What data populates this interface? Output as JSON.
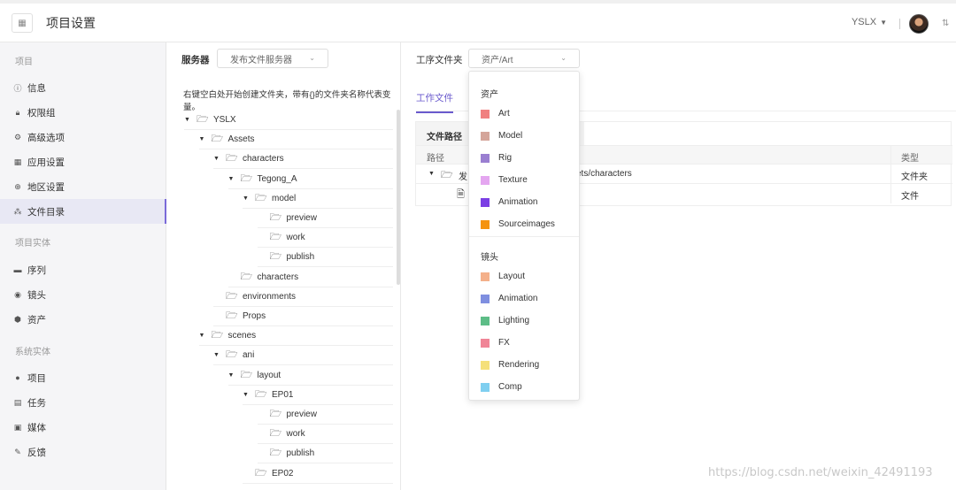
{
  "header": {
    "title": "项目设置",
    "user": "YSLX",
    "apps_icon": "grid-icon",
    "sort_icon": "sort-icon"
  },
  "sidebar": {
    "section_project": "项目",
    "project_items": [
      {
        "label": "信息",
        "icon": "info-icon"
      },
      {
        "label": "权限组",
        "icon": "lock-icon"
      },
      {
        "label": "高级选项",
        "icon": "settings-icon"
      },
      {
        "label": "应用设置",
        "icon": "apps-icon"
      },
      {
        "label": "地区设置",
        "icon": "globe-icon"
      },
      {
        "label": "文件目录",
        "icon": "tree-icon",
        "active": true
      }
    ],
    "section_entities": "项目实体",
    "entity_items": [
      {
        "label": "序列",
        "icon": "sequence-icon"
      },
      {
        "label": "镜头",
        "icon": "shot-icon"
      },
      {
        "label": "资产",
        "icon": "asset-icon"
      }
    ],
    "section_system": "系统实体",
    "system_items": [
      {
        "label": "项目",
        "icon": "project-icon"
      },
      {
        "label": "任务",
        "icon": "task-icon"
      },
      {
        "label": "媒体",
        "icon": "media-icon"
      },
      {
        "label": "反馈",
        "icon": "feedback-icon"
      }
    ]
  },
  "tree_panel": {
    "server_label": "服务器",
    "server_value": "发布文件服务器",
    "hint": "右键空白处开始创建文件夹，带有{}的文件夹名称代表变量。",
    "nodes": [
      {
        "label": "YSLX",
        "level": 0,
        "expanded": true
      },
      {
        "label": "Assets",
        "level": 1,
        "expanded": true
      },
      {
        "label": "characters",
        "level": 2,
        "expanded": true
      },
      {
        "label": "Tegong_A",
        "level": 3,
        "expanded": true
      },
      {
        "label": "model",
        "level": 4,
        "expanded": true
      },
      {
        "label": "preview",
        "level": 5
      },
      {
        "label": "work",
        "level": 5
      },
      {
        "label": "publish",
        "level": 5
      },
      {
        "label": "characters",
        "level": 3
      },
      {
        "label": "environments",
        "level": 2
      },
      {
        "label": "Props",
        "level": 2
      },
      {
        "label": "scenes",
        "level": 1,
        "expanded": true
      },
      {
        "label": "ani",
        "level": 2,
        "expanded": true
      },
      {
        "label": "layout",
        "level": 3,
        "expanded": true
      },
      {
        "label": "EP01",
        "level": 4,
        "expanded": true
      },
      {
        "label": "preview",
        "level": 5
      },
      {
        "label": "work",
        "level": 5
      },
      {
        "label": "publish",
        "level": 5
      },
      {
        "label": "EP02",
        "level": 4
      }
    ]
  },
  "right_panel": {
    "folder_label": "工序文件夹",
    "folder_value": "资产/Art",
    "tab": "工作文件",
    "path_header": "文件路径",
    "col_path": "路径",
    "col_type": "类型",
    "rows": [
      {
        "path_prefix": "发",
        "path_suffix": "ets/characters",
        "type": "文件夹"
      },
      {
        "path_prefix": "",
        "path_suffix": "",
        "type": "文件"
      }
    ]
  },
  "dropdown": {
    "group_asset": "资产",
    "asset_items": [
      {
        "label": "Art",
        "color": "#f08080"
      },
      {
        "label": "Model",
        "color": "#d4a59a"
      },
      {
        "label": "Rig",
        "color": "#9a7fd1"
      },
      {
        "label": "Texture",
        "color": "#e4a6f0"
      },
      {
        "label": "Animation",
        "color": "#7b3fe4"
      },
      {
        "label": "Sourceimages",
        "color": "#f5930f"
      }
    ],
    "group_shot": "镜头",
    "shot_items": [
      {
        "label": "Layout",
        "color": "#f4b08a"
      },
      {
        "label": "Animation",
        "color": "#7f8fe0"
      },
      {
        "label": "Lighting",
        "color": "#5dbd87"
      },
      {
        "label": "FX",
        "color": "#f08597"
      },
      {
        "label": "Rendering",
        "color": "#f5e07a"
      },
      {
        "label": "Comp",
        "color": "#7fcff0"
      }
    ]
  },
  "watermark": "https://blog.csdn.net/weixin_42491193"
}
